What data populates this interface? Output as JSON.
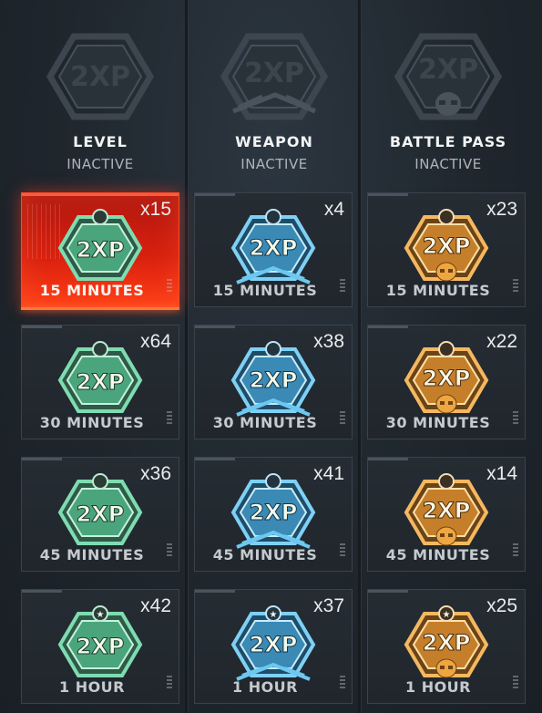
{
  "columns": [
    {
      "title": "LEVEL",
      "status": "INACTIVE",
      "badge_text": "2XP",
      "icon": "level-2xp-icon",
      "accent": "#5fd0a0"
    },
    {
      "title": "WEAPON",
      "status": "INACTIVE",
      "badge_text": "2XP",
      "icon": "weapon-2xp-icon",
      "accent": "#4fb8e8"
    },
    {
      "title": "BATTLE PASS",
      "status": "INACTIVE",
      "badge_text": "2XP",
      "icon": "battle-pass-2xp-icon",
      "accent": "#f0a640"
    }
  ],
  "tokens": {
    "level": [
      {
        "qty": "x15",
        "duration": "15 MINUTES",
        "selected": true
      },
      {
        "qty": "x64",
        "duration": "30 MINUTES"
      },
      {
        "qty": "x36",
        "duration": "45 MINUTES"
      },
      {
        "qty": "x42",
        "duration": "1 HOUR"
      }
    ],
    "weapon": [
      {
        "qty": "x4",
        "duration": "15 MINUTES"
      },
      {
        "qty": "x38",
        "duration": "30 MINUTES"
      },
      {
        "qty": "x41",
        "duration": "45 MINUTES"
      },
      {
        "qty": "x37",
        "duration": "1 HOUR"
      }
    ],
    "battle_pass": [
      {
        "qty": "x23",
        "duration": "15 MINUTES"
      },
      {
        "qty": "x22",
        "duration": "30 MINUTES"
      },
      {
        "qty": "x14",
        "duration": "45 MINUTES"
      },
      {
        "qty": "x25",
        "duration": "1 HOUR"
      }
    ]
  }
}
